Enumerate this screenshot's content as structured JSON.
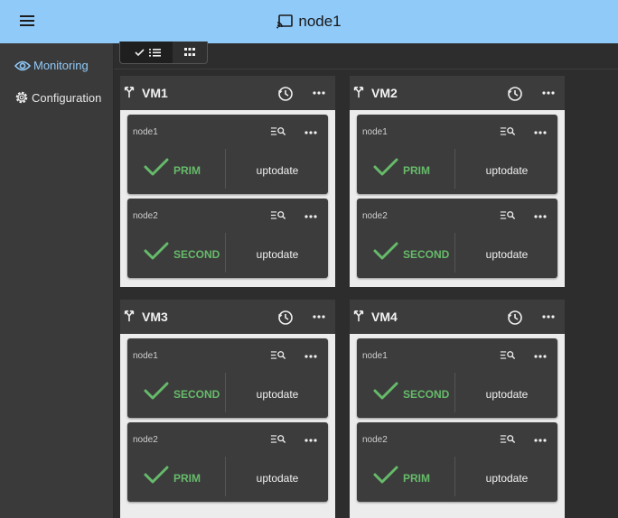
{
  "header": {
    "title": "node1",
    "menu_icon": "menu-icon",
    "title_icon": "cast-icon"
  },
  "sidebar": {
    "items": [
      {
        "label": "Monitoring",
        "icon": "eye-icon",
        "active": true
      },
      {
        "label": "Configuration",
        "icon": "gear-icon",
        "active": false
      }
    ]
  },
  "view_toggle": {
    "selected": "list",
    "options": [
      "list",
      "grid"
    ]
  },
  "colors": {
    "accent": "#90caf9",
    "ok": "#66bb6a",
    "panel": "#3c3c3c"
  },
  "vms": [
    {
      "name": "VM1",
      "nodes": [
        {
          "name": "node1",
          "role": "PRIM",
          "state": "uptodate"
        },
        {
          "name": "node2",
          "role": "SECOND",
          "state": "uptodate"
        }
      ]
    },
    {
      "name": "VM2",
      "nodes": [
        {
          "name": "node1",
          "role": "PRIM",
          "state": "uptodate"
        },
        {
          "name": "node2",
          "role": "SECOND",
          "state": "uptodate"
        }
      ]
    },
    {
      "name": "VM3",
      "nodes": [
        {
          "name": "node1",
          "role": "SECOND",
          "state": "uptodate"
        },
        {
          "name": "node2",
          "role": "PRIM",
          "state": "uptodate"
        }
      ]
    },
    {
      "name": "VM4",
      "nodes": [
        {
          "name": "node1",
          "role": "SECOND",
          "state": "uptodate"
        },
        {
          "name": "node2",
          "role": "PRIM",
          "state": "uptodate"
        }
      ]
    }
  ]
}
